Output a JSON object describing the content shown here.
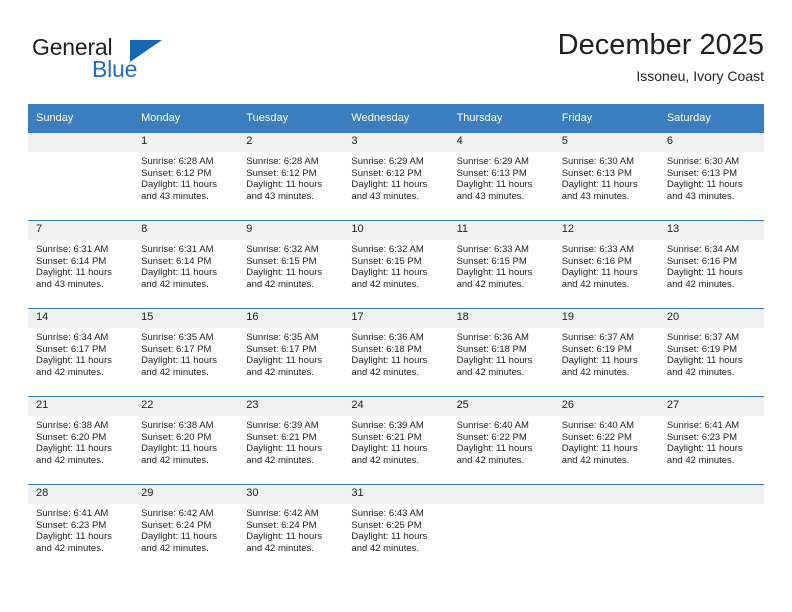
{
  "brand": {
    "word_one": "General",
    "word_two": "Blue",
    "triangle_color": "#1568b4",
    "blue_text_color": "#1f6fc4"
  },
  "header": {
    "title": "December 2025",
    "subtitle": "Issoneu, Ivory Coast"
  },
  "theme": {
    "header_bg": "#3a7ebf",
    "header_text": "#ffffff",
    "daynum_bg": "#f0f0f0",
    "body_text": "#231f20",
    "row_border": "#3a7ebf"
  },
  "weekday_headers": [
    "Sunday",
    "Monday",
    "Tuesday",
    "Wednesday",
    "Thursday",
    "Friday",
    "Saturday"
  ],
  "labels": {
    "sunrise_prefix": "Sunrise: ",
    "sunset_prefix": "Sunset: ",
    "daylight_prefix": "Daylight: "
  },
  "weeks": [
    [
      {
        "day": "",
        "sunrise": "",
        "sunset": "",
        "daylight": ""
      },
      {
        "day": "1",
        "sunrise": "Sunrise: 6:28 AM",
        "sunset": "Sunset: 6:12 PM",
        "daylight": "Daylight: 11 hours and 43 minutes."
      },
      {
        "day": "2",
        "sunrise": "Sunrise: 6:28 AM",
        "sunset": "Sunset: 6:12 PM",
        "daylight": "Daylight: 11 hours and 43 minutes."
      },
      {
        "day": "3",
        "sunrise": "Sunrise: 6:29 AM",
        "sunset": "Sunset: 6:12 PM",
        "daylight": "Daylight: 11 hours and 43 minutes."
      },
      {
        "day": "4",
        "sunrise": "Sunrise: 6:29 AM",
        "sunset": "Sunset: 6:13 PM",
        "daylight": "Daylight: 11 hours and 43 minutes."
      },
      {
        "day": "5",
        "sunrise": "Sunrise: 6:30 AM",
        "sunset": "Sunset: 6:13 PM",
        "daylight": "Daylight: 11 hours and 43 minutes."
      },
      {
        "day": "6",
        "sunrise": "Sunrise: 6:30 AM",
        "sunset": "Sunset: 6:13 PM",
        "daylight": "Daylight: 11 hours and 43 minutes."
      }
    ],
    [
      {
        "day": "7",
        "sunrise": "Sunrise: 6:31 AM",
        "sunset": "Sunset: 6:14 PM",
        "daylight": "Daylight: 11 hours and 43 minutes."
      },
      {
        "day": "8",
        "sunrise": "Sunrise: 6:31 AM",
        "sunset": "Sunset: 6:14 PM",
        "daylight": "Daylight: 11 hours and 42 minutes."
      },
      {
        "day": "9",
        "sunrise": "Sunrise: 6:32 AM",
        "sunset": "Sunset: 6:15 PM",
        "daylight": "Daylight: 11 hours and 42 minutes."
      },
      {
        "day": "10",
        "sunrise": "Sunrise: 6:32 AM",
        "sunset": "Sunset: 6:15 PM",
        "daylight": "Daylight: 11 hours and 42 minutes."
      },
      {
        "day": "11",
        "sunrise": "Sunrise: 6:33 AM",
        "sunset": "Sunset: 6:15 PM",
        "daylight": "Daylight: 11 hours and 42 minutes."
      },
      {
        "day": "12",
        "sunrise": "Sunrise: 6:33 AM",
        "sunset": "Sunset: 6:16 PM",
        "daylight": "Daylight: 11 hours and 42 minutes."
      },
      {
        "day": "13",
        "sunrise": "Sunrise: 6:34 AM",
        "sunset": "Sunset: 6:16 PM",
        "daylight": "Daylight: 11 hours and 42 minutes."
      }
    ],
    [
      {
        "day": "14",
        "sunrise": "Sunrise: 6:34 AM",
        "sunset": "Sunset: 6:17 PM",
        "daylight": "Daylight: 11 hours and 42 minutes."
      },
      {
        "day": "15",
        "sunrise": "Sunrise: 6:35 AM",
        "sunset": "Sunset: 6:17 PM",
        "daylight": "Daylight: 11 hours and 42 minutes."
      },
      {
        "day": "16",
        "sunrise": "Sunrise: 6:35 AM",
        "sunset": "Sunset: 6:17 PM",
        "daylight": "Daylight: 11 hours and 42 minutes."
      },
      {
        "day": "17",
        "sunrise": "Sunrise: 6:36 AM",
        "sunset": "Sunset: 6:18 PM",
        "daylight": "Daylight: 11 hours and 42 minutes."
      },
      {
        "day": "18",
        "sunrise": "Sunrise: 6:36 AM",
        "sunset": "Sunset: 6:18 PM",
        "daylight": "Daylight: 11 hours and 42 minutes."
      },
      {
        "day": "19",
        "sunrise": "Sunrise: 6:37 AM",
        "sunset": "Sunset: 6:19 PM",
        "daylight": "Daylight: 11 hours and 42 minutes."
      },
      {
        "day": "20",
        "sunrise": "Sunrise: 6:37 AM",
        "sunset": "Sunset: 6:19 PM",
        "daylight": "Daylight: 11 hours and 42 minutes."
      }
    ],
    [
      {
        "day": "21",
        "sunrise": "Sunrise: 6:38 AM",
        "sunset": "Sunset: 6:20 PM",
        "daylight": "Daylight: 11 hours and 42 minutes."
      },
      {
        "day": "22",
        "sunrise": "Sunrise: 6:38 AM",
        "sunset": "Sunset: 6:20 PM",
        "daylight": "Daylight: 11 hours and 42 minutes."
      },
      {
        "day": "23",
        "sunrise": "Sunrise: 6:39 AM",
        "sunset": "Sunset: 6:21 PM",
        "daylight": "Daylight: 11 hours and 42 minutes."
      },
      {
        "day": "24",
        "sunrise": "Sunrise: 6:39 AM",
        "sunset": "Sunset: 6:21 PM",
        "daylight": "Daylight: 11 hours and 42 minutes."
      },
      {
        "day": "25",
        "sunrise": "Sunrise: 6:40 AM",
        "sunset": "Sunset: 6:22 PM",
        "daylight": "Daylight: 11 hours and 42 minutes."
      },
      {
        "day": "26",
        "sunrise": "Sunrise: 6:40 AM",
        "sunset": "Sunset: 6:22 PM",
        "daylight": "Daylight: 11 hours and 42 minutes."
      },
      {
        "day": "27",
        "sunrise": "Sunrise: 6:41 AM",
        "sunset": "Sunset: 6:23 PM",
        "daylight": "Daylight: 11 hours and 42 minutes."
      }
    ],
    [
      {
        "day": "28",
        "sunrise": "Sunrise: 6:41 AM",
        "sunset": "Sunset: 6:23 PM",
        "daylight": "Daylight: 11 hours and 42 minutes."
      },
      {
        "day": "29",
        "sunrise": "Sunrise: 6:42 AM",
        "sunset": "Sunset: 6:24 PM",
        "daylight": "Daylight: 11 hours and 42 minutes."
      },
      {
        "day": "30",
        "sunrise": "Sunrise: 6:42 AM",
        "sunset": "Sunset: 6:24 PM",
        "daylight": "Daylight: 11 hours and 42 minutes."
      },
      {
        "day": "31",
        "sunrise": "Sunrise: 6:43 AM",
        "sunset": "Sunset: 6:25 PM",
        "daylight": "Daylight: 11 hours and 42 minutes."
      },
      {
        "day": "",
        "sunrise": "",
        "sunset": "",
        "daylight": ""
      },
      {
        "day": "",
        "sunrise": "",
        "sunset": "",
        "daylight": ""
      },
      {
        "day": "",
        "sunrise": "",
        "sunset": "",
        "daylight": ""
      }
    ]
  ]
}
